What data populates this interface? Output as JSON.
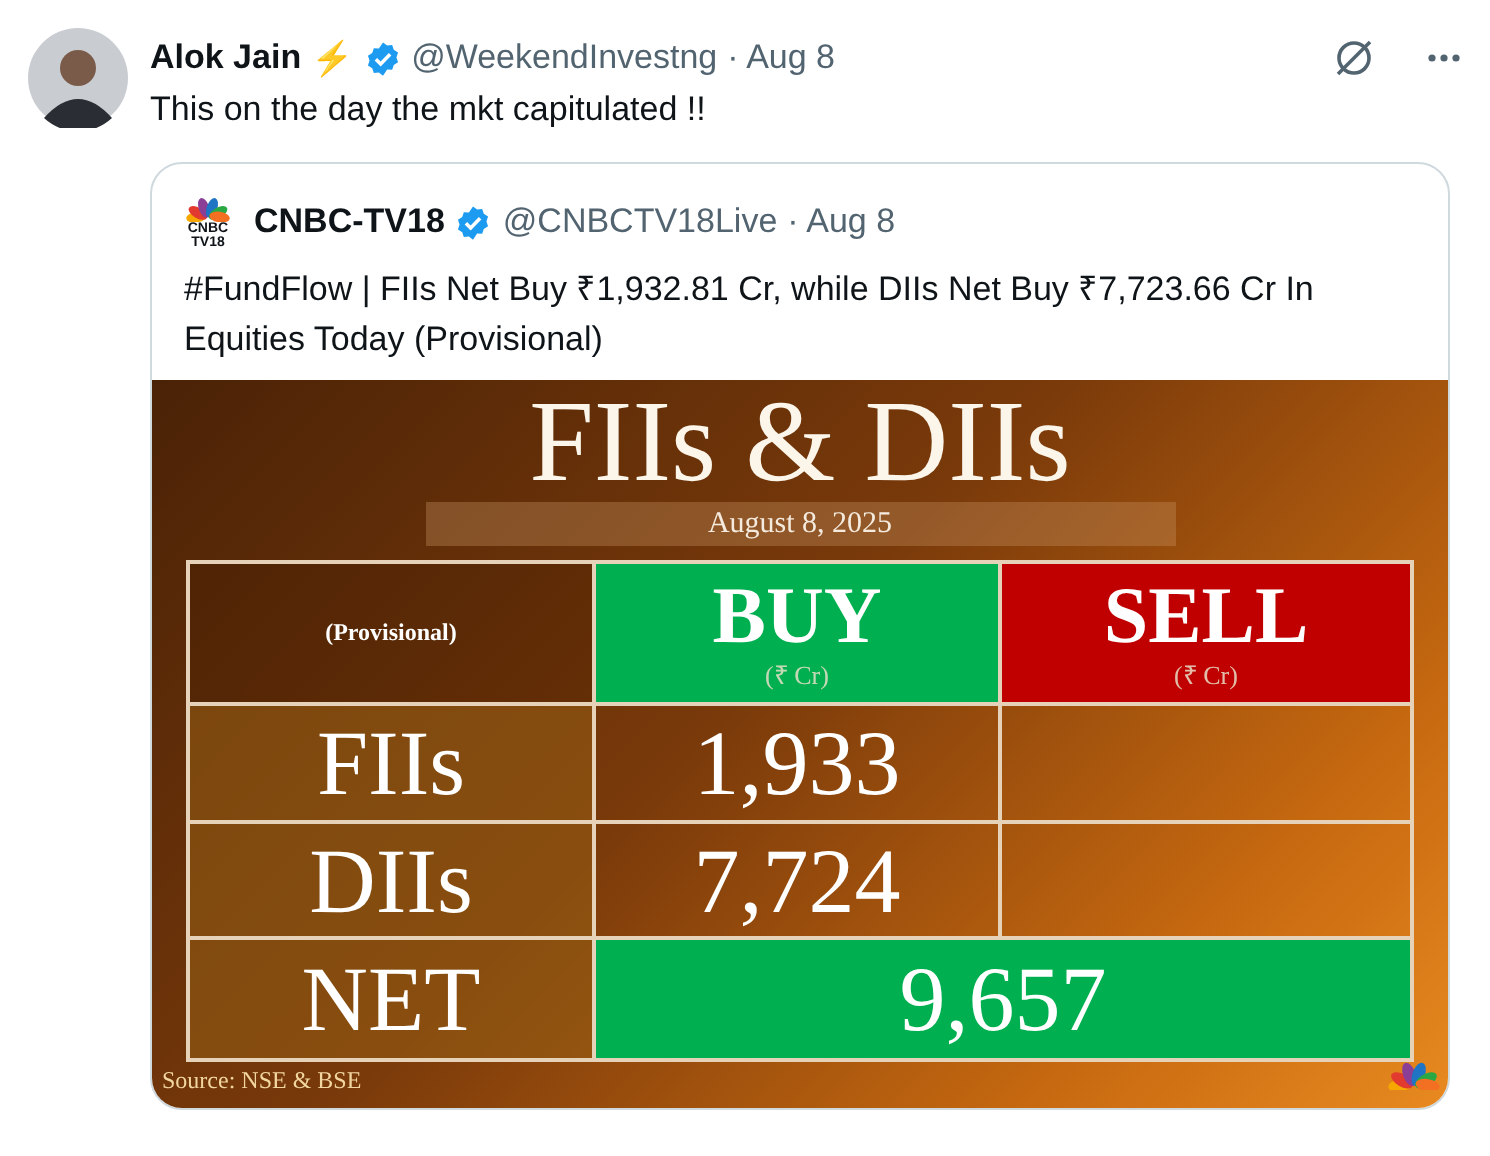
{
  "tweet": {
    "author": {
      "name": "Alok Jain",
      "emoji": "⚡",
      "verified": true,
      "handle": "@WeekendInvestng",
      "date": "· Aug 8"
    },
    "text": "This on the day the mkt capitulated !!",
    "quote": {
      "logo": {
        "lines": [
          "CNBC",
          "TV18"
        ]
      },
      "author": {
        "name": "CNBC-TV18",
        "verified": true,
        "handle": "@CNBCTV18Live",
        "date": "· Aug 8"
      },
      "text": "#FundFlow | FIIs Net Buy ₹1,932.81 Cr, while DIIs Net Buy ₹7,723.66 Cr In Equities Today (Provisional)",
      "image": {
        "title": "FIIs & DIIs",
        "date": "August 8, 2025",
        "table": {
          "corner": "(Provisional)",
          "columns": [
            {
              "label": "BUY",
              "unit": "(₹ Cr)",
              "color": "#00b050"
            },
            {
              "label": "SELL",
              "unit": "(₹ Cr)",
              "color": "#c00000"
            }
          ],
          "rows": [
            {
              "label": "FIIs",
              "kind": "entry",
              "cells": [
                "1,933"
              ]
            },
            {
              "label": "DIIs",
              "kind": "entry",
              "cells": [
                "7,724"
              ]
            },
            {
              "label": "NET",
              "kind": "total",
              "cells": [
                "9,657"
              ]
            }
          ]
        },
        "source": "Source: NSE & BSE"
      }
    }
  }
}
